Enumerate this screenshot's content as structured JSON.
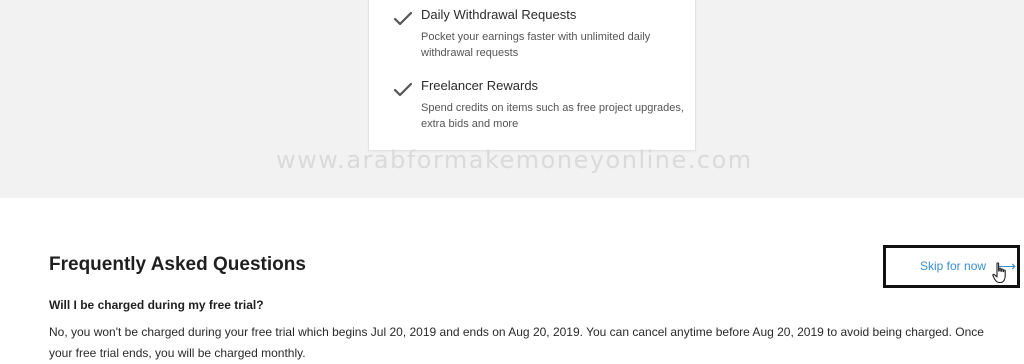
{
  "benefits": [
    {
      "title": "Daily Withdrawal Requests",
      "description": "Pocket your earnings faster with unlimited daily withdrawal requests",
      "icon": "check-icon"
    },
    {
      "title": "Freelancer Rewards",
      "description": "Spend credits on items such as free project upgrades, extra bids and more",
      "icon": "check-icon"
    }
  ],
  "watermark": "www.arabformakemoneyonline.com",
  "faq": {
    "title": "Frequently Asked Questions",
    "skip_label": "Skip for now",
    "question": "Will I be charged during my free trial?",
    "answer": "No, you won't be charged during your free trial which begins Jul 20, 2019 and ends on Aug 20, 2019. You can cancel anytime before Aug 20, 2019 to avoid being charged. Once your free trial ends, you will be charged monthly."
  },
  "colors": {
    "link": "#3b8fd1",
    "top_band": "#f2f2f2",
    "highlight_border": "#111111"
  }
}
